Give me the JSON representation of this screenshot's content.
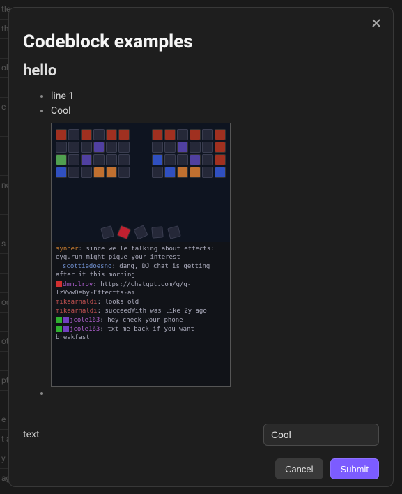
{
  "background": {
    "items": [
      "tle",
      "th",
      "",
      "olo",
      "",
      "e y",
      "",
      "",
      "",
      "no",
      "",
      "",
      "s",
      "",
      "",
      "oc",
      "",
      "ot",
      "",
      "pt",
      "",
      "e",
      "t a",
      "y a",
      "ag"
    ]
  },
  "modal": {
    "title": "Codeblock examples",
    "subtitle": "hello",
    "list": [
      "line 1",
      "Cool"
    ],
    "screenshot": {
      "chat": [
        {
          "nick": "synner",
          "nickClass": "nick-org",
          "badges": [],
          "text": " since we le talking about effects: eyg.run might pique your interest"
        },
        {
          "nick": "scottiedoesno",
          "nickClass": "nick-blue",
          "badges": [
            "b-drk"
          ],
          "text": " dang, DJ chat is getting after it this morning"
        },
        {
          "nick": "dmmulroy",
          "nickClass": "nick-pur",
          "badges": [
            "b-red"
          ],
          "text": " https://chatgpt.com/g/g-lzVwwDeby-Effectts-ai"
        },
        {
          "nick": "mikearnaldi",
          "nickClass": "nick-red",
          "badges": [],
          "text": " looks old"
        },
        {
          "nick": "mikearnaldi",
          "nickClass": "nick-red",
          "badges": [],
          "text": " succeedWith was like 2y ago"
        },
        {
          "nick": "jcole163",
          "nickClass": "nick-pur",
          "badges": [
            "b-grn",
            "b-pur"
          ],
          "text": " hey check your phone"
        },
        {
          "nick": "jcole163",
          "nickClass": "nick-pur",
          "badges": [
            "b-grn",
            "b-pur"
          ],
          "text": " txt me back if you want breakfast"
        }
      ]
    },
    "form": {
      "label": "text",
      "value": "Cool"
    },
    "buttons": {
      "cancel": "Cancel",
      "submit": "Submit"
    }
  }
}
